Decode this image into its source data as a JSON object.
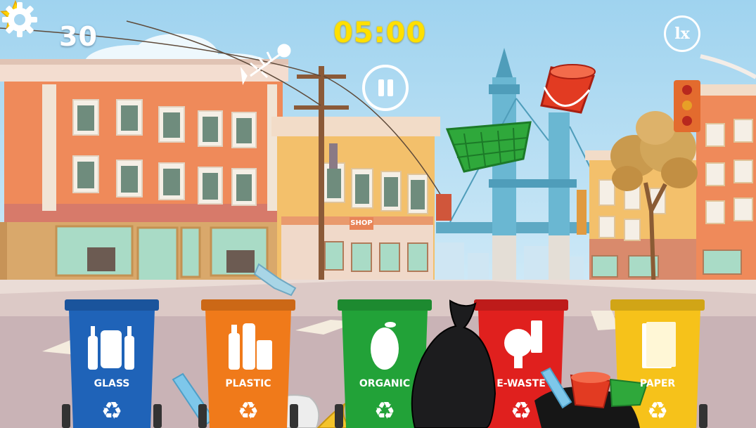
{
  "hud": {
    "score": "30",
    "timer": "05:00",
    "speed_label": "lx",
    "star_icon": "star-icon",
    "pause_icon": "pause-icon",
    "settings_icon": "gear-icon"
  },
  "scene": {
    "shop_sign": "SHOP"
  },
  "bins": [
    {
      "label": "GLASS",
      "color": "#1f63b8"
    },
    {
      "label": "PLASTIC",
      "color": "#f07a1a"
    },
    {
      "label": "ORGANIC",
      "color": "#22a238"
    },
    {
      "label": "E-WASTE",
      "color": "#e0201e"
    },
    {
      "label": "PAPER",
      "color": "#f6c21a"
    }
  ],
  "colors": {
    "sky": "#bfe2f4",
    "road": "#d9c9c8",
    "timer": "#ffe000"
  }
}
